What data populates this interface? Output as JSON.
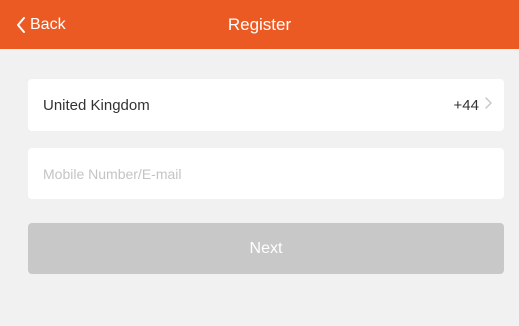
{
  "nav": {
    "back_label": "Back",
    "title": "Register",
    "back_icon": "chevron-left-icon",
    "bar_color": "#ec5a24"
  },
  "country": {
    "name": "United Kingdom",
    "code": "+44",
    "arrow_icon": "chevron-right-icon"
  },
  "form": {
    "account_placeholder": "Mobile Number/E-mail",
    "account_value": ""
  },
  "actions": {
    "next_label": "Next",
    "next_color": "#c8c8c8"
  }
}
